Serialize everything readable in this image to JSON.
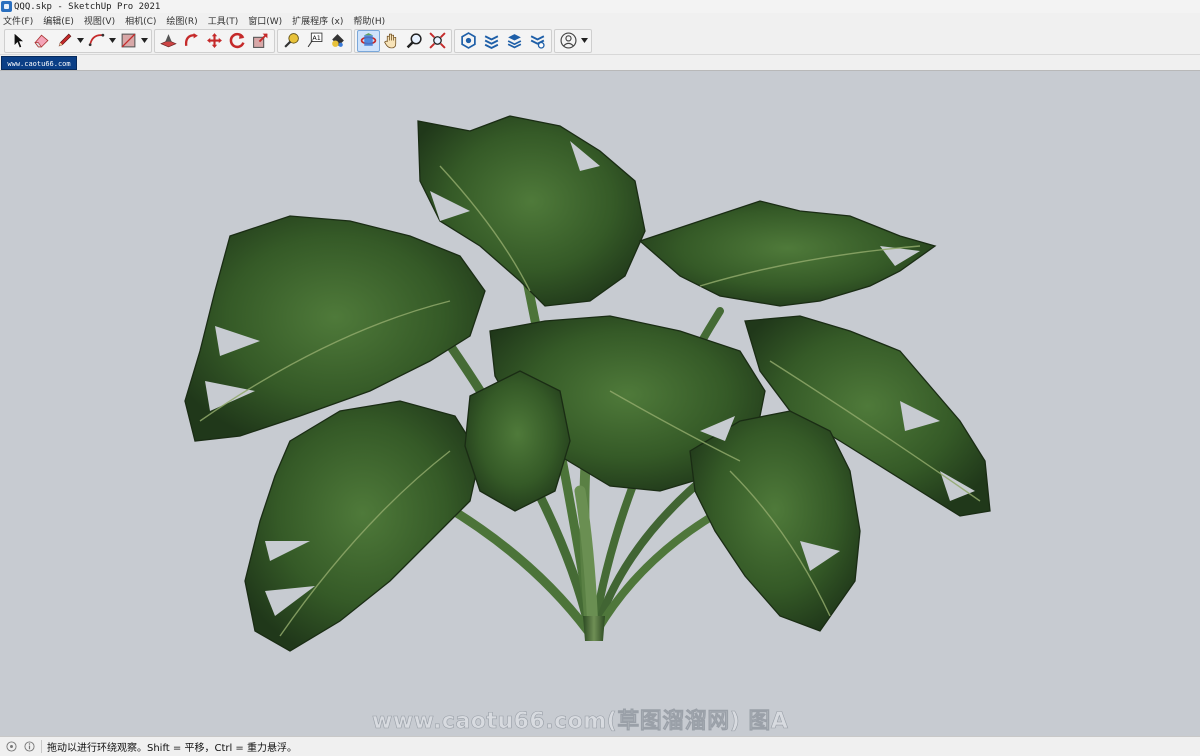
{
  "window": {
    "title": "QQQ.skp - SketchUp Pro 2021"
  },
  "menu": [
    "文件(F)",
    "编辑(E)",
    "视图(V)",
    "相机(C)",
    "绘图(R)",
    "工具(T)",
    "窗口(W)",
    "扩展程序 (x)",
    "帮助(H)"
  ],
  "toolbar": {
    "tools": [
      "select-tool",
      "eraser-tool",
      "pencil-tool",
      "arc-tool",
      "rectangle-tool",
      "push-pull-tool",
      "follow-me-tool",
      "move-tool",
      "rotate-tool",
      "scale-tool",
      "tape-measure-tool",
      "text-tool",
      "paint-bucket-tool",
      "orbit-tool",
      "pan-tool",
      "zoom-tool",
      "zoom-extents-tool",
      "warehouse-tool",
      "extension-warehouse-tool",
      "layout-tool",
      "extension-manager-tool",
      "account-tool"
    ],
    "active_tool": "orbit-tool",
    "text_tool_label": "A1"
  },
  "scene": {
    "tab_label": "www.caotu66.com"
  },
  "viewport": {
    "background": "#c7cbd1",
    "watermark": "www.caotu66.com(草图溜溜网) 图A"
  },
  "status": {
    "message": "拖动以进行环绕观察。Shift = 平移，Ctrl = 重力悬浮。"
  }
}
